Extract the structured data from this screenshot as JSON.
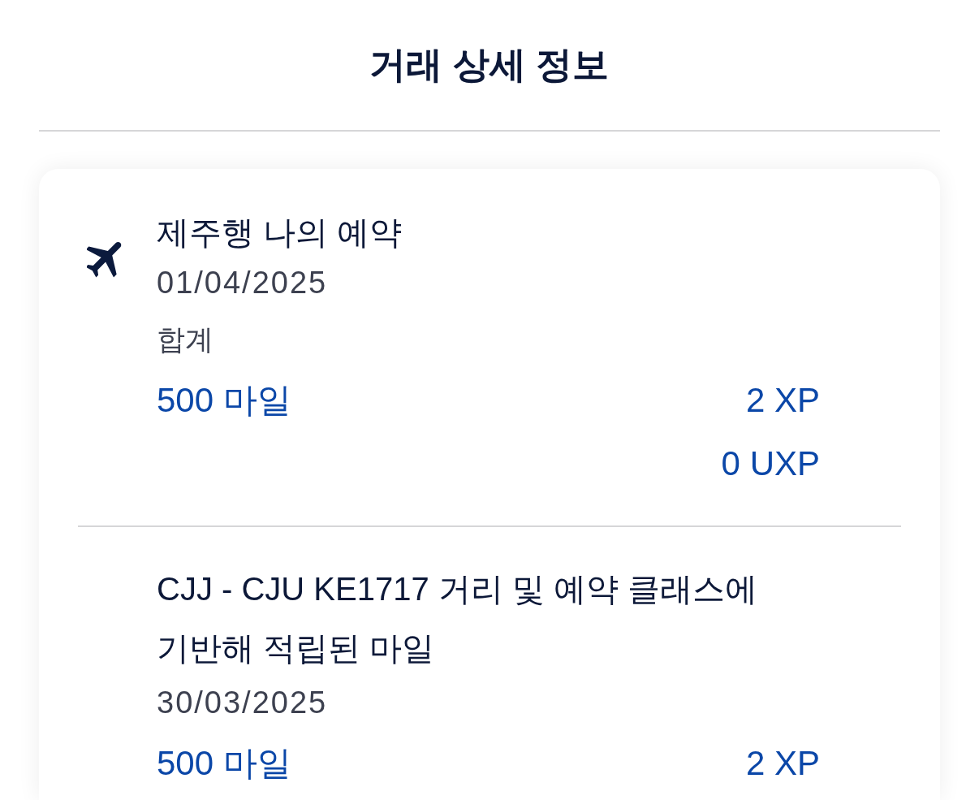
{
  "header": {
    "title": "거래 상세 정보"
  },
  "transactions": [
    {
      "kind": "flight",
      "title": "제주행 나의 예약",
      "date": "01/04/2025",
      "total_label": "합계",
      "miles": "500 마일",
      "points": [
        "2 XP",
        "0 UXP"
      ]
    },
    {
      "kind": "accrual",
      "title": "CJJ - CJU KE1717 거리 및 예약 클래스에 기반해 적립된 마일",
      "date": "30/03/2025",
      "miles": "500 마일",
      "points": [
        "2 XP"
      ]
    }
  ]
}
